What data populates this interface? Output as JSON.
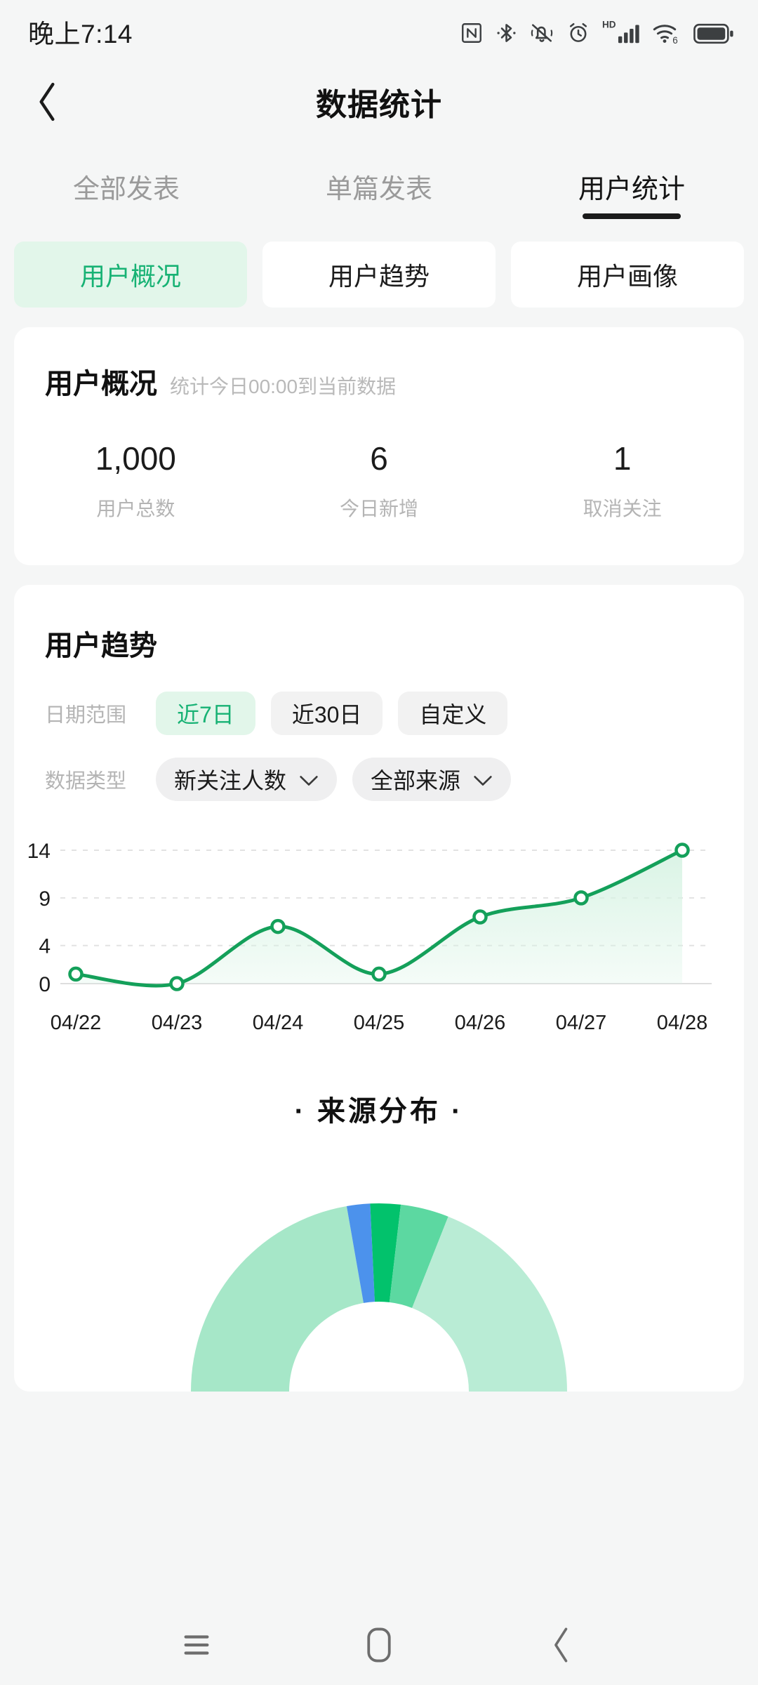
{
  "status_bar": {
    "time": "晚上7:14",
    "icons": [
      "nfc-icon",
      "bluetooth-icon",
      "mute-vibrate-icon",
      "alarm-icon",
      "hd-signal-icon",
      "wifi6-icon",
      "battery-icon"
    ]
  },
  "header": {
    "back_label": "‹",
    "title": "数据统计"
  },
  "tabs": [
    {
      "label": "全部发表",
      "active": false
    },
    {
      "label": "单篇发表",
      "active": false
    },
    {
      "label": "用户统计",
      "active": true
    }
  ],
  "subtabs": [
    {
      "label": "用户概况",
      "active": true
    },
    {
      "label": "用户趋势",
      "active": false
    },
    {
      "label": "用户画像",
      "active": false
    }
  ],
  "overview": {
    "title": "用户概况",
    "subtitle": "统计今日00:00到当前数据",
    "stats": [
      {
        "value": "1,000",
        "label": "用户总数"
      },
      {
        "value": "6",
        "label": "今日新增"
      },
      {
        "value": "1",
        "label": "取消关注"
      }
    ]
  },
  "trend": {
    "title": "用户趋势",
    "date_range_label": "日期范围",
    "date_ranges": [
      {
        "label": "近7日",
        "active": true
      },
      {
        "label": "近30日",
        "active": false
      },
      {
        "label": "自定义",
        "active": false
      }
    ],
    "data_type_label": "数据类型",
    "selects": [
      {
        "value": "新关注人数",
        "icon": "chevron-down-icon"
      },
      {
        "value": "全部来源",
        "icon": "chevron-down-icon"
      }
    ]
  },
  "chart_data": {
    "type": "line",
    "title": "用户趋势",
    "xlabel": "",
    "ylabel": "",
    "categories": [
      "04/22",
      "04/23",
      "04/24",
      "04/25",
      "04/26",
      "04/27",
      "04/28"
    ],
    "values": [
      1,
      0,
      6,
      1,
      7,
      9,
      14
    ],
    "yticks": [
      0,
      4,
      9,
      14
    ],
    "ylim": [
      0,
      14
    ],
    "grid": true,
    "legend": "none",
    "series_name": "新关注人数",
    "line_color": "#14a05a",
    "area_color": "#d8f3e4"
  },
  "source_chart": {
    "title": "· 来源分布 ·",
    "type": "pie",
    "segments": [
      {
        "name": "segment-1",
        "percent": 44.5,
        "color": "#a6e7c8"
      },
      {
        "name": "segment-2",
        "percent": 4.0,
        "color": "#4c92ec"
      },
      {
        "name": "segment-3",
        "percent": 5.2,
        "color": "#02c26c"
      },
      {
        "name": "segment-4",
        "percent": 8.3,
        "color": "#5cd8a1"
      },
      {
        "name": "segment-5",
        "percent": 38.0,
        "color": "#b9ecd5"
      }
    ]
  },
  "navbar": {
    "recents_icon": "menu-icon",
    "home_icon": "home-icon",
    "back_icon": "back-chevron-icon"
  },
  "colors": {
    "accent_green": "#17b274",
    "accent_bg": "#e2f6ea",
    "page_bg": "#f5f6f6",
    "card_bg": "#ffffff"
  }
}
